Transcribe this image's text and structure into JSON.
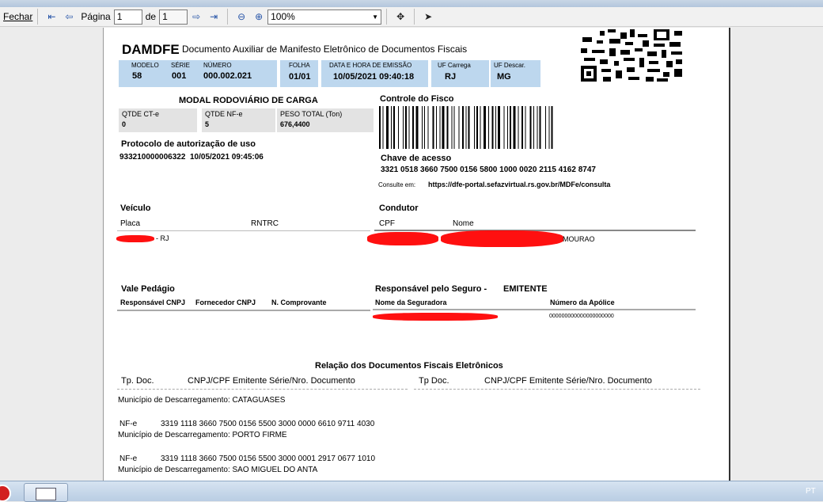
{
  "toolbar": {
    "close": "Fechar",
    "page_label": "Página",
    "page_value": "1",
    "page_of": "de",
    "page_total": "1",
    "zoom": "100%"
  },
  "doc": {
    "title": "DAMDFE",
    "subtitle": "Documento Auxiliar de Manifesto Eletrônico de Documentos Fiscais",
    "modelo_l": "MODELO",
    "modelo": "58",
    "serie_l": "SÉRIE",
    "serie": "001",
    "numero_l": "NÚMERO",
    "numero": "000.002.021",
    "folha_l": "FOLHA",
    "folha": "01/01",
    "data_l": "DATA E HORA DE EMISSÃO",
    "data": "10/05/2021 09:40:18",
    "ufc_l": "UF Carrega",
    "ufc": "RJ",
    "ufd_l": "UF Descar.",
    "ufd": "MG",
    "modal": "MODAL RODOVIÁRIO DE CARGA",
    "qcte_l": "QTDE CT-e",
    "qcte": "0",
    "qnfe_l": "QTDE NF-e",
    "qnfe": "5",
    "peso_l": "PESO TOTAL (Ton)",
    "peso": "676,4400",
    "controle": "Controle do Fisco",
    "prot_l": "Protocolo de autorização de uso",
    "prot": "933210000006322  10/05/2021 09:45:06",
    "chave_l": "Chave de acesso",
    "chave": "3321 0518 3660 7500 0156 5800 1000 0020 2115 4162 8747",
    "consulte": "Consulte em:",
    "consulte_url": "https://dfe-portal.sefazvirtual.rs.gov.br/MDFe/consulta",
    "veiculo": "Veículo",
    "placa_l": "Placa",
    "rntrc_l": "RNTRC",
    "placa_tail": "- RJ",
    "condutor": "Condutor",
    "cpf_l": "CPF",
    "nome_l": "Nome",
    "nome_tail": "MOURAO",
    "vale": "Vale Pedágio",
    "resp_cnpj": "Responsável CNPJ",
    "forn_cnpj": "Fornecedor CNPJ",
    "ncomp": "N. Comprovante",
    "seguro": "Responsável pelo Seguro -",
    "seguro_resp": "EMITENTE",
    "seguradora_l": "Nome da Seguradora",
    "apolice_l": "Número da Apólice",
    "apolice": "000000000000000000000",
    "relacao": "Relação dos Documentos Fiscais Eletrônicos",
    "tpdoc1": "Tp. Doc.",
    "cnpj1": "CNPJ/CPF Emitente",
    "serie1": "Série/Nro. Documento",
    "tpdoc2": "Tp Doc.",
    "cnpj2": "CNPJ/CPF Emitente",
    "serie2": "Série/Nro. Documento",
    "rows": [
      {
        "mun": "Município de Descarregamento: CATAGUASES",
        "tp": "NF-e",
        "num": "3319 1118 3660 7500 0156 5500 3000 0000 6610 9711 4030"
      },
      {
        "mun": "Município de Descarregamento: PORTO FIRME",
        "tp": "NF-e",
        "num": "3319 1118 3660 7500 0156 5500 3000 0001 2917 0677 1010"
      },
      {
        "mun": "Município de Descarregamento: SAO MIGUEL DO ANTA"
      }
    ]
  },
  "taskbar": {
    "lang": "PT"
  }
}
